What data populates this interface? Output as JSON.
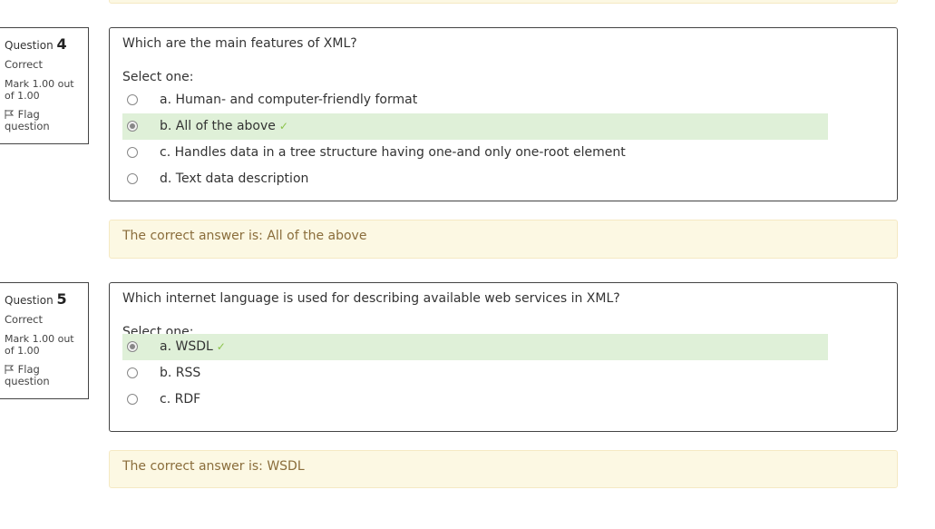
{
  "questions": [
    {
      "label": "Question",
      "number": "4",
      "state": "Correct",
      "grade_line1": "Mark 1.00 out",
      "grade_line2": "of 1.00",
      "flag_line1": "Flag",
      "flag_line2": "question",
      "text": "Which are the main features of XML?",
      "prompt": "Select one:",
      "options": [
        {
          "label": "a. Human- and computer-friendly format",
          "selected": false,
          "correct": false
        },
        {
          "label": "b. All of the above",
          "selected": true,
          "correct": true
        },
        {
          "label": "c. Handles data in a tree structure having one-and only one-root element",
          "selected": false,
          "correct": false
        },
        {
          "label": "d. Text data description",
          "selected": false,
          "correct": false
        }
      ],
      "feedback": "The correct answer is: All of the above"
    },
    {
      "label": "Question",
      "number": "5",
      "state": "Correct",
      "grade_line1": "Mark 1.00 out",
      "grade_line2": "of 1.00",
      "flag_line1": "Flag",
      "flag_line2": "question",
      "text": "Which internet language is used for describing available web services in XML?",
      "prompt": "Select one:",
      "options": [
        {
          "label": "a. WSDL",
          "selected": true,
          "correct": true
        },
        {
          "label": "b. RSS",
          "selected": false,
          "correct": false
        },
        {
          "label": "c. RDF",
          "selected": false,
          "correct": false
        }
      ],
      "feedback": "The correct answer is: WSDL"
    }
  ],
  "colors": {
    "correct_bg": "#dff0d8",
    "feedback_bg": "#fcf8e3",
    "feedback_text": "#8a6d3b",
    "check": "#8bc34a"
  },
  "icons": {
    "flag": "flag-icon",
    "check": "check-icon"
  }
}
